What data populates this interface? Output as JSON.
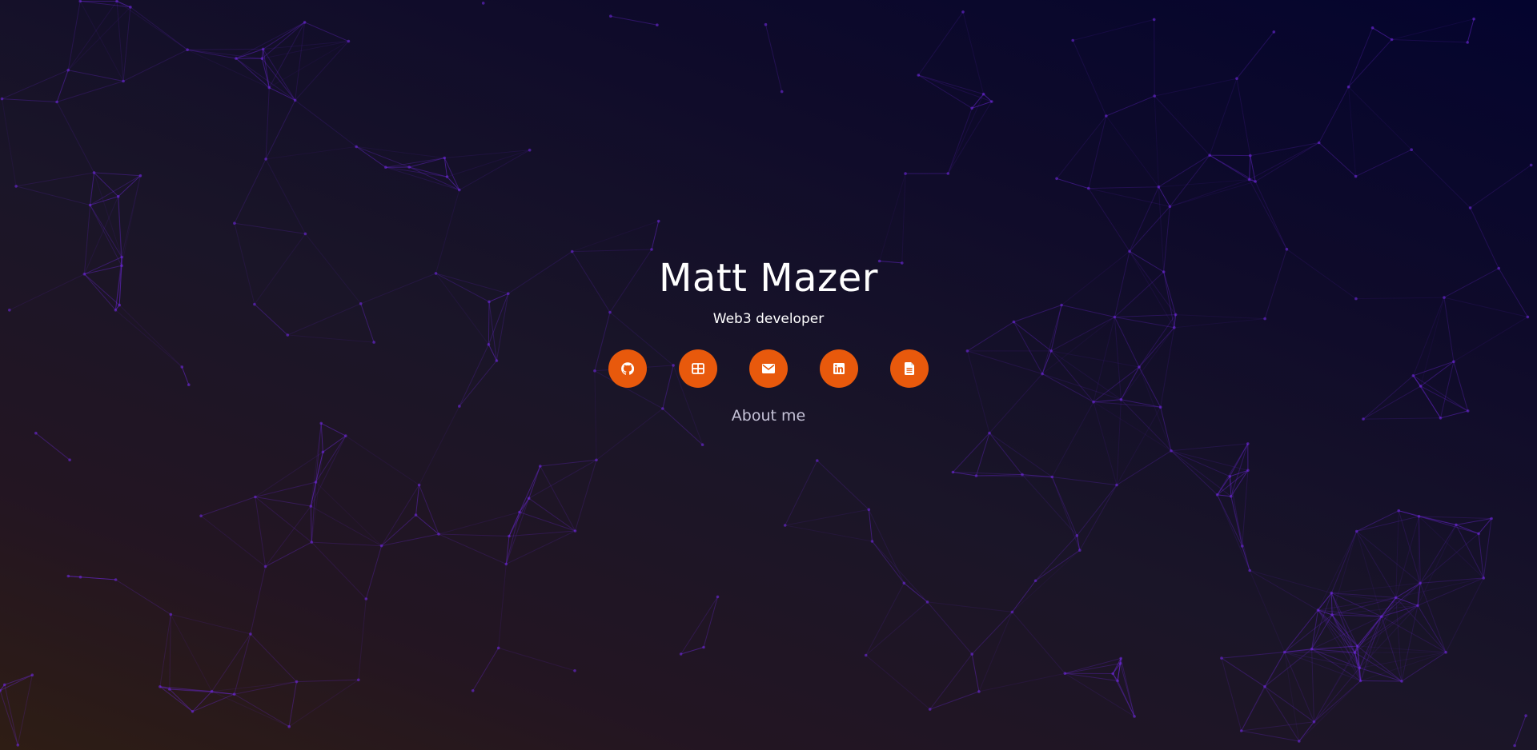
{
  "hero": {
    "name": "Matt Mazer",
    "tagline": "Web3 developer",
    "about_link": "About me"
  },
  "socials": [
    {
      "icon": "github-icon",
      "name": "github-button"
    },
    {
      "icon": "grid-icon",
      "name": "portfolio-button"
    },
    {
      "icon": "envelope-icon",
      "name": "email-button"
    },
    {
      "icon": "linkedin-icon",
      "name": "linkedin-button"
    },
    {
      "icon": "document-icon",
      "name": "resume-button"
    }
  ],
  "colors": {
    "accent": "#e8590c",
    "network_line": "#6d28d9",
    "text": "#ffffff",
    "muted_text": "#c6c3d8"
  }
}
